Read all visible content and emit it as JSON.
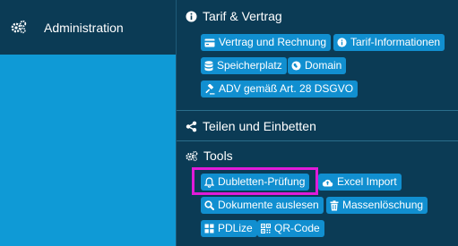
{
  "sidebar": {
    "item_label": "Administration",
    "item_icon": "gears-icon"
  },
  "menu": {
    "sections": [
      {
        "title": "Tarif & Vertrag",
        "icon": "info-circle-icon",
        "buttons": [
          {
            "label": "Vertrag und Rechnung",
            "icon": "credit-card-icon"
          },
          {
            "label": "Tarif-Informationen",
            "icon": "info-circle-icon"
          },
          {
            "label": "Speicherplatz",
            "icon": "database-icon"
          },
          {
            "label": "Domain",
            "icon": "globe-icon"
          },
          {
            "label": "ADV gemäß Art. 28 DSGVO",
            "icon": "gavel-icon"
          }
        ]
      },
      {
        "title": "Teilen und Einbetten",
        "icon": "share-icon",
        "buttons": []
      },
      {
        "title": "Tools",
        "icon": "gears-icon",
        "buttons": [
          {
            "label": "Dubletten-Prüfung",
            "icon": "bell-icon",
            "highlighted": true
          },
          {
            "label": "Excel Import",
            "icon": "cloud-upload-icon"
          },
          {
            "label": "Dokumente auslesen",
            "icon": "search-icon"
          },
          {
            "label": "Massenlöschung",
            "icon": "trash-icon"
          },
          {
            "label": "PDLize",
            "icon": "grid-icon"
          },
          {
            "label": "QR-Code",
            "icon": "qrcode-icon"
          }
        ]
      }
    ]
  },
  "colors": {
    "panel_bg": "#0b3b55",
    "page_bg": "#0f9ad6",
    "button_bg": "#118fd0",
    "highlight": "#e01bd9"
  }
}
